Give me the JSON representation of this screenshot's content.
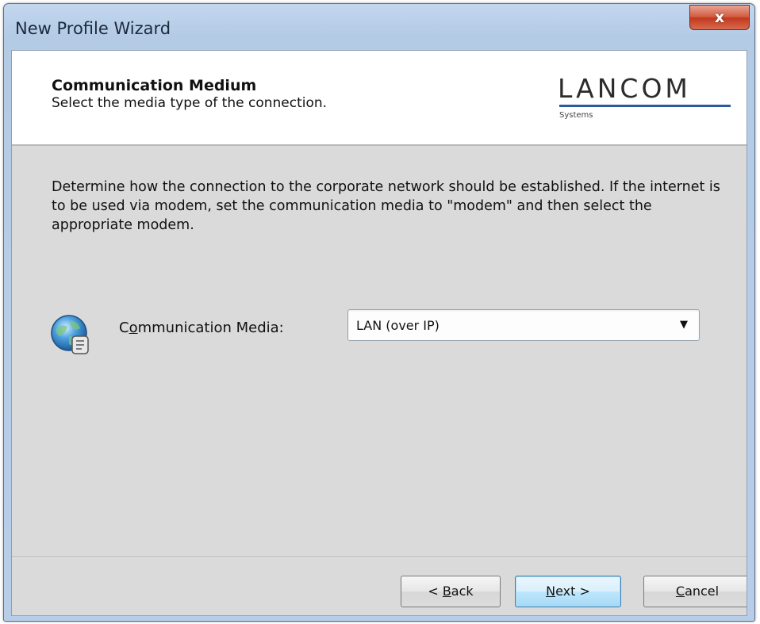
{
  "window": {
    "title": "New Profile Wizard",
    "close_label": "x"
  },
  "header": {
    "title": "Communication Medium",
    "subtitle": "Select the media type of the connection.",
    "logo_text": "LANCOM",
    "logo_sub": "Systems"
  },
  "body": {
    "description": "Determine how the connection to the corporate network should be established. If the internet is to be used via modem, set the communication media to \"modem\" and then select the appropriate modem.",
    "media_label_pre": "C",
    "media_label_mnemonic": "o",
    "media_label_post": "mmunication Media:",
    "media_value": "LAN (over IP)",
    "media_icon": "globe-connection-icon"
  },
  "buttons": {
    "back_pre": "< ",
    "back_mnemonic": "B",
    "back_post": "ack",
    "next_mnemonic": "N",
    "next_post": "ext >",
    "cancel_mnemonic": "C",
    "cancel_post": "ancel"
  },
  "colors": {
    "close_button": "#c9452b",
    "logo_line": "#2c5aa0",
    "default_button_border": "#3c7fb1"
  }
}
